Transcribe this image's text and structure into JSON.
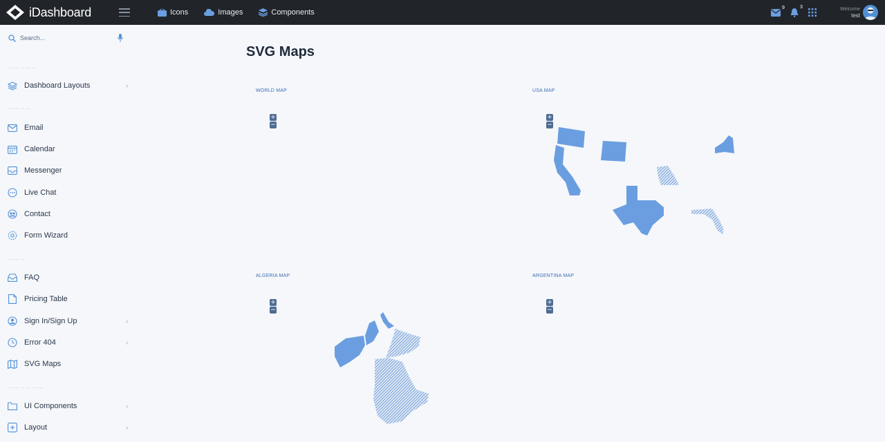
{
  "brand": {
    "name": "iDashboard"
  },
  "topnav": [
    {
      "label": "Icons",
      "icon": "briefcase-icon"
    },
    {
      "label": "Images",
      "icon": "cloud-icon"
    },
    {
      "label": "Components",
      "icon": "layers-icon"
    }
  ],
  "header": {
    "mail_count": "9",
    "notification_count": "3",
    "user_greeting": "Welcome",
    "user_name": "test"
  },
  "search": {
    "placeholder": "Search..."
  },
  "sidebar": {
    "items": [
      {
        "label": "Dashboard Layouts",
        "icon": "layers-icon",
        "chevron": true
      },
      {
        "label": "Email",
        "icon": "envelope-icon"
      },
      {
        "label": "Calendar",
        "icon": "calendar-icon"
      },
      {
        "label": "Messenger",
        "icon": "inbox-icon"
      },
      {
        "label": "Live Chat",
        "icon": "chat-icon"
      },
      {
        "label": "Contact",
        "icon": "users-icon"
      },
      {
        "label": "Form Wizard",
        "icon": "settings-icon"
      },
      {
        "label": "FAQ",
        "icon": "tray-icon"
      },
      {
        "label": "Pricing Table",
        "icon": "document-icon"
      },
      {
        "label": "Sign In/Sign Up",
        "icon": "user-icon",
        "chevron": true
      },
      {
        "label": "Error 404",
        "icon": "clock-icon",
        "chevron": true
      },
      {
        "label": "SVG Maps",
        "icon": "map-icon"
      },
      {
        "label": "UI Components",
        "icon": "folder-icon",
        "chevron": true
      },
      {
        "label": "Layout",
        "icon": "add-square-icon",
        "chevron": true
      }
    ]
  },
  "main": {
    "title": "SVG Maps",
    "maps": [
      {
        "label": "WORLD MAP"
      },
      {
        "label": "USA MAP"
      },
      {
        "label": "ALGERIA MAP"
      },
      {
        "label": "ARGENTINA MAP"
      }
    ],
    "zoom_in": "+",
    "zoom_out": "−"
  },
  "colors": {
    "topbar": "#212529",
    "accent": "#4f8fd6",
    "map_fill": "#6a9ee0",
    "background": "#f5f7fb"
  }
}
